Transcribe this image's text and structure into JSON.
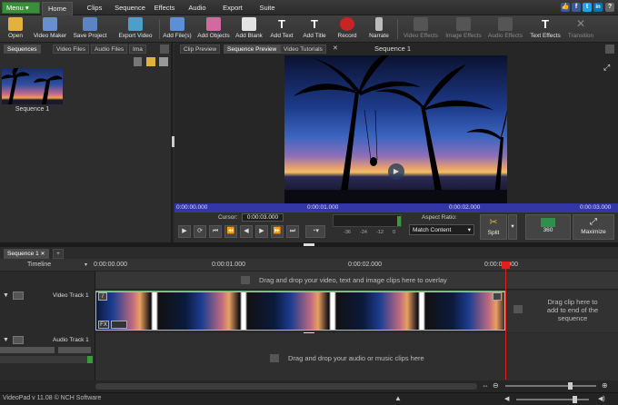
{
  "menubar": {
    "menu_label": "Menu ▾",
    "tabs": [
      "Home",
      "Clips",
      "Sequence",
      "Effects",
      "Audio",
      "Export",
      "Suite"
    ],
    "social": [
      "t",
      "f",
      "t",
      "in",
      "?"
    ]
  },
  "toolbar": {
    "buttons": [
      "Open",
      "Video Maker",
      "Save Project",
      "Export Video",
      "Add File(s)",
      "Add Objects",
      "Add Blank",
      "Add Text",
      "Add Title",
      "Record",
      "Narrate",
      "Video Effects",
      "Image Effects",
      "Audio Effects",
      "Text Effects",
      "Transition"
    ]
  },
  "left_panel": {
    "tabs": [
      "Sequences",
      "Video Files",
      "Audio Files",
      "Ima"
    ],
    "sequence_label": "Sequence 1"
  },
  "right_panel": {
    "tabs": [
      "Clip Preview",
      "Sequence Preview",
      "Video Tutorials"
    ],
    "title": "Sequence 1",
    "time_labels": [
      "0:00:00.000",
      "0:00:01.000",
      "0:00:02.000",
      "0:00:03.000"
    ],
    "cursor_label": "Cursor:",
    "cursor_value": "0:00:03.000",
    "meter_labels": [
      "-36",
      "-24",
      "-12",
      "0"
    ],
    "aspect_label": "Aspect Ratio:",
    "aspect_value": "Match Content",
    "split_label": "Split",
    "vr_label": "360",
    "maximize_label": "Maximize"
  },
  "timeline": {
    "tab": "Sequence 1",
    "timeline_label": "Timeline",
    "ruler": [
      "0:00:00.000",
      "0:00:01.000",
      "0:00:02.000",
      "0:00:03.000"
    ],
    "overlay_hint": "Drag and drop your video, text and image clips here to overlay",
    "video_track_label": "Video Track 1",
    "audio_track_label": "Audio Track 1",
    "end_hint_line1": "Drag clip here to",
    "end_hint_line2": "add to end of the",
    "end_hint_line3": "sequence",
    "audio_hint": "Drag and drop your audio or music clips here",
    "fx_label": "FX"
  },
  "status": {
    "text": "VideoPad v 11.08 © NCH Software"
  },
  "colors": {
    "accent_green": "#3b8f3b",
    "timebar_blue": "#3436a8",
    "playhead_red": "#e02020"
  }
}
